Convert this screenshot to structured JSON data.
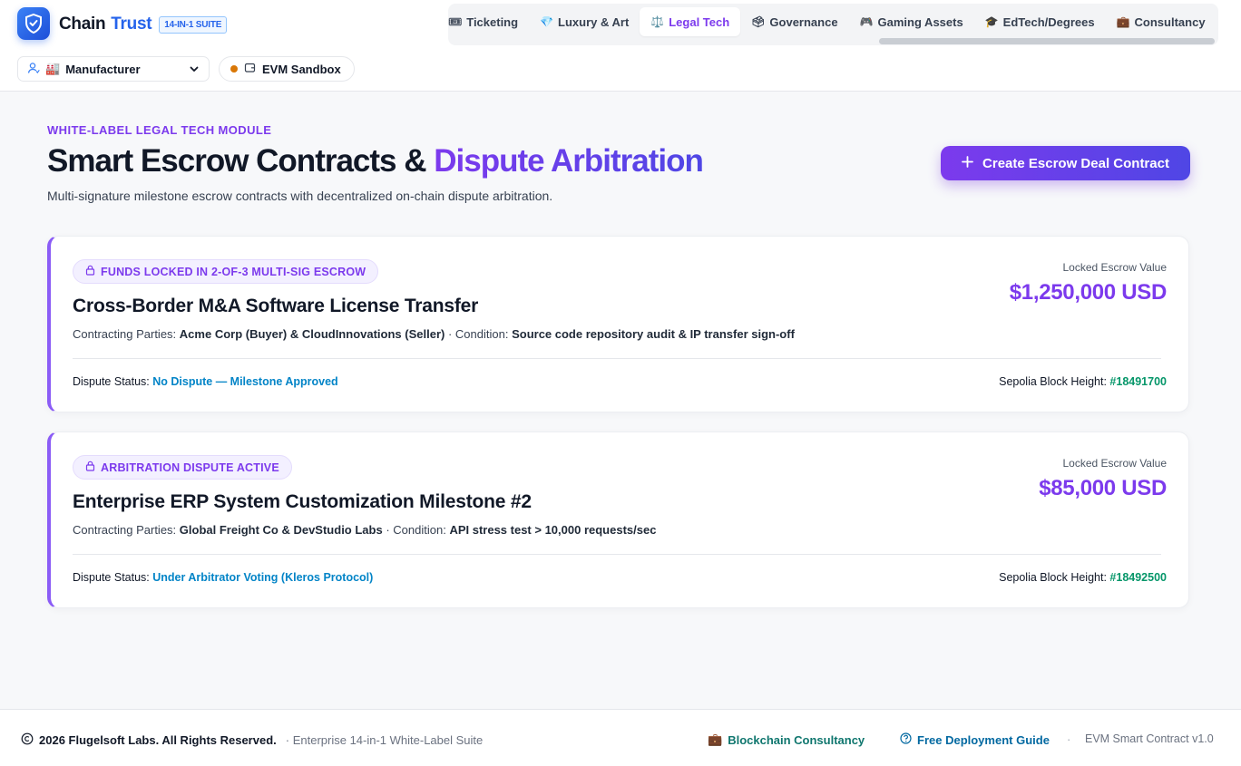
{
  "brand": {
    "name_part1": "Chain",
    "name_part2": "Trust",
    "badge": "14-IN-1 SUITE"
  },
  "role_selector": {
    "icon": "user-icon",
    "emoji": "🏭",
    "value": "Manufacturer"
  },
  "network": {
    "label": "EVM Sandbox",
    "status_color": "#d97706"
  },
  "tabs": [
    {
      "icon": "🎟",
      "label": "Ticketing",
      "active": false
    },
    {
      "icon": "💎",
      "label": "Luxury & Art",
      "active": false
    },
    {
      "icon": "⚖️",
      "label": "Legal Tech",
      "active": true
    },
    {
      "icon": "🗳",
      "label": "Governance",
      "active": false
    },
    {
      "icon": "🎮",
      "label": "Gaming Assets",
      "active": false
    },
    {
      "icon": "🎓",
      "label": "EdTech/Degrees",
      "active": false
    },
    {
      "icon": "💼",
      "label": "Consultancy",
      "active": false
    }
  ],
  "page": {
    "eyebrow": "WHITE-LABEL LEGAL TECH MODULE",
    "title_main": "Smart Escrow Contracts & ",
    "title_accent": "Dispute Arbitration",
    "subtitle": "Multi-signature milestone escrow contracts with decentralized on-chain dispute arbitration.",
    "create_button": "Create Escrow Deal Contract"
  },
  "labels": {
    "contracting_parties": "Contracting Parties:",
    "condition": "Condition:",
    "locked_escrow_value": "Locked Escrow Value",
    "dispute_status": "Dispute Status:",
    "block_height": "Sepolia Block Height:"
  },
  "contracts": [
    {
      "status": "FUNDS LOCKED IN 2-OF-3 MULTI-SIG ESCROW",
      "title": "Cross-Border M&A Software License Transfer",
      "parties": "Acme Corp (Buyer) & CloudInnovations (Seller)",
      "condition": "Source code repository audit & IP transfer sign-off",
      "value": "$1,250,000 USD",
      "dispute": "No Dispute — Milestone Approved",
      "block": "#18491700"
    },
    {
      "status": "ARBITRATION DISPUTE ACTIVE",
      "title": "Enterprise ERP System Customization Milestone #2",
      "parties": "Global Freight Co & DevStudio Labs",
      "condition": "API stress test > 10,000 requests/sec",
      "value": "$85,000 USD",
      "dispute": "Under Arbitrator Voting (Kleros Protocol)",
      "block": "#18492500"
    }
  ],
  "footer": {
    "copyright": "2026 Flugelsoft Labs. All Rights Reserved.",
    "suite": "· Enterprise 14-in-1 White-Label Suite",
    "consultancy_link": "Blockchain Consultancy",
    "guide_link": "Free Deployment Guide",
    "separator": "·",
    "version": "EVM Smart Contract v1.0"
  },
  "colors": {
    "brand_blue": "#2563eb",
    "accent_purple": "#7c3aed",
    "dispute_blue": "#0284c7",
    "block_green": "#059669"
  }
}
